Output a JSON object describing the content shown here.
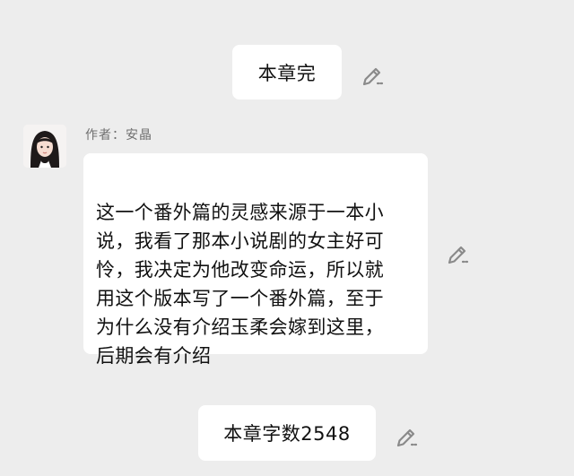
{
  "messages": {
    "chapter_end": "本章完",
    "author_label": "作者：安晶",
    "note": "这一个番外篇的灵感来源于一本小\n说，我看了那本小说剧的女主好可\n怜，我决定为他改变命运，所以就\n用这个版本写了一个番外篇，至于\n为什么没有介绍玉柔会嫁到这里，\n后期会有介绍",
    "word_count": "本章字数2548"
  },
  "icons": {
    "edit": "pencil-edit-icon",
    "avatar": "author-avatar"
  },
  "colors": {
    "background": "#ededed",
    "bubble": "#ffffff",
    "icon": "#8a8a8a"
  }
}
